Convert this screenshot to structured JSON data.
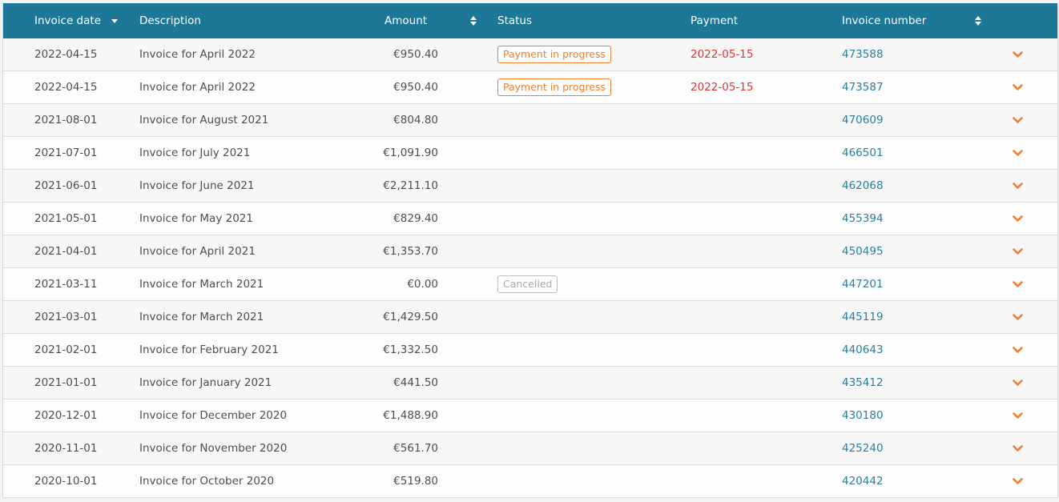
{
  "colors": {
    "header_bg": "#1c7896",
    "accent_orange": "#f07f2d",
    "payment_red": "#d9383a",
    "link_blue": "#2a7fa0"
  },
  "table": {
    "columns": {
      "invoice_date": "Invoice date",
      "description": "Description",
      "amount": "Amount",
      "status": "Status",
      "payment": "Payment",
      "invoice_number": "Invoice number"
    },
    "sort_icons": {
      "invoice_date": "sort-desc-icon",
      "amount": "sort-both-icon",
      "invoice_number": "sort-both-icon"
    },
    "rows": [
      {
        "date": "2022-04-15",
        "description": "Invoice for April 2022",
        "amount": "€950.40",
        "status": "Payment in progress",
        "status_type": "progress",
        "payment": "2022-05-15",
        "invoice_number": "473588"
      },
      {
        "date": "2022-04-15",
        "description": "Invoice for April 2022",
        "amount": "€950.40",
        "status": "Payment in progress",
        "status_type": "progress",
        "payment": "2022-05-15",
        "invoice_number": "473587"
      },
      {
        "date": "2021-08-01",
        "description": "Invoice for August 2021",
        "amount": "€804.80",
        "status": "",
        "status_type": "",
        "payment": "",
        "invoice_number": "470609"
      },
      {
        "date": "2021-07-01",
        "description": "Invoice for July 2021",
        "amount": "€1,091.90",
        "status": "",
        "status_type": "",
        "payment": "",
        "invoice_number": "466501"
      },
      {
        "date": "2021-06-01",
        "description": "Invoice for June 2021",
        "amount": "€2,211.10",
        "status": "",
        "status_type": "",
        "payment": "",
        "invoice_number": "462068"
      },
      {
        "date": "2021-05-01",
        "description": "Invoice for May 2021",
        "amount": "€829.40",
        "status": "",
        "status_type": "",
        "payment": "",
        "invoice_number": "455394"
      },
      {
        "date": "2021-04-01",
        "description": "Invoice for April 2021",
        "amount": "€1,353.70",
        "status": "",
        "status_type": "",
        "payment": "",
        "invoice_number": "450495"
      },
      {
        "date": "2021-03-11",
        "description": "Invoice for March 2021",
        "amount": "€0.00",
        "status": "Cancelled",
        "status_type": "cancelled",
        "payment": "",
        "invoice_number": "447201"
      },
      {
        "date": "2021-03-01",
        "description": "Invoice for March 2021",
        "amount": "€1,429.50",
        "status": "",
        "status_type": "",
        "payment": "",
        "invoice_number": "445119"
      },
      {
        "date": "2021-02-01",
        "description": "Invoice for February 2021",
        "amount": "€1,332.50",
        "status": "",
        "status_type": "",
        "payment": "",
        "invoice_number": "440643"
      },
      {
        "date": "2021-01-01",
        "description": "Invoice for January 2021",
        "amount": "€441.50",
        "status": "",
        "status_type": "",
        "payment": "",
        "invoice_number": "435412"
      },
      {
        "date": "2020-12-01",
        "description": "Invoice for December 2020",
        "amount": "€1,488.90",
        "status": "",
        "status_type": "",
        "payment": "",
        "invoice_number": "430180"
      },
      {
        "date": "2020-11-01",
        "description": "Invoice for November 2020",
        "amount": "€561.70",
        "status": "",
        "status_type": "",
        "payment": "",
        "invoice_number": "425240"
      },
      {
        "date": "2020-10-01",
        "description": "Invoice for October 2020",
        "amount": "€519.80",
        "status": "",
        "status_type": "",
        "payment": "",
        "invoice_number": "420442"
      }
    ]
  }
}
